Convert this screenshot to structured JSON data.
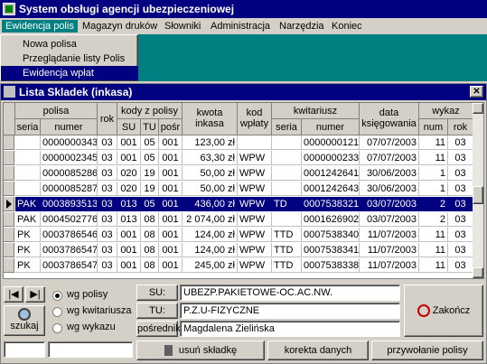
{
  "app": {
    "title": "System obsługi agencji ubezpieczeniowej"
  },
  "menu": [
    {
      "label": "Ewidencja polis"
    },
    {
      "label": "Magazyn druków"
    },
    {
      "label": "Słowniki"
    },
    {
      "label": "Administracja"
    },
    {
      "label": "Narzędzia"
    },
    {
      "label": "Koniec"
    }
  ],
  "dropdown": [
    "Nowa polisa",
    "Przeglądanie listy Polis",
    "Ewidencja wpłat"
  ],
  "window": {
    "title": "Lista Skladek (inkasa)",
    "close": "✕"
  },
  "grid": {
    "group_headers": {
      "polisa": "polisa",
      "rok": "rok",
      "kody": "kody z polisy",
      "kwota": "kwota inkasa",
      "kod": "kod wpłaty",
      "kwitariusz": "kwitariusz",
      "data": "data księgowania",
      "wykaz": "wykaz"
    },
    "sub_headers": {
      "seria": "seria",
      "numer": "numer",
      "su": "SU",
      "tu": "TU",
      "posr": "pośr",
      "kseria": "seria",
      "knumer": "numer",
      "num": "num",
      "wrok": "rok"
    },
    "rows": [
      [
        "",
        "0000000343",
        "03",
        "001",
        "05",
        "001",
        "123,00 zł",
        "",
        "",
        "0000000121",
        "07/07/2003",
        "11",
        "03"
      ],
      [
        "",
        "0000002345",
        "03",
        "001",
        "05",
        "001",
        "63,30 zł",
        "WPW",
        "",
        "0000000233",
        "07/07/2003",
        "11",
        "03"
      ],
      [
        "",
        "0000085286",
        "03",
        "020",
        "19",
        "001",
        "50,00 zł",
        "WPW",
        "",
        "0001242641",
        "30/06/2003",
        "1",
        "03"
      ],
      [
        "",
        "0000085287",
        "03",
        "020",
        "19",
        "001",
        "50,00 zł",
        "WPW",
        "",
        "0001242643",
        "30/06/2003",
        "1",
        "03"
      ],
      [
        "PAK",
        "0003893513",
        "03",
        "013",
        "05",
        "001",
        "436,00 zł",
        "WPW",
        "TD",
        "0007538321",
        "03/07/2003",
        "2",
        "03"
      ],
      [
        "PAK",
        "0004502776",
        "03",
        "013",
        "08",
        "001",
        "2 074,00 zł",
        "WPW",
        "",
        "0001626902",
        "03/07/2003",
        "2",
        "03"
      ],
      [
        "PK",
        "0003786546",
        "03",
        "001",
        "08",
        "001",
        "124,00 zł",
        "WPW",
        "TTD",
        "0007538340",
        "11/07/2003",
        "11",
        "03"
      ],
      [
        "PK",
        "0003786547",
        "03",
        "001",
        "08",
        "001",
        "124,00 zł",
        "WPW",
        "TTD",
        "0007538341",
        "11/07/2003",
        "11",
        "03"
      ],
      [
        "PK",
        "0003786547",
        "03",
        "001",
        "08",
        "001",
        "245,00 zł",
        "WPW",
        "TTD",
        "0007538338",
        "11/07/2003",
        "11",
        "03"
      ]
    ],
    "selected_row": 4
  },
  "search": {
    "options": [
      "wg polisy",
      "wg kwitariusza",
      "wg wykazu"
    ],
    "selected": 0,
    "button": "szukaj"
  },
  "details": {
    "su_label": "SU:",
    "su_value": "UBEZP.PAKIETOWE-OC.AC.NW.",
    "tu_label": "TU:",
    "tu_value": "P.Z.U-FIZYCZNE",
    "posrednik_label": "pośrednik",
    "posrednik_value": "Magdalena Zielińska"
  },
  "buttons": {
    "close": "Zakończ",
    "delete": "usuń składkę",
    "correct": "korekta danych",
    "recall": "przywołanie polisy"
  },
  "colors": {
    "title_bar": "#000080",
    "desktop": "#008080",
    "face": "#d4d0c8"
  }
}
